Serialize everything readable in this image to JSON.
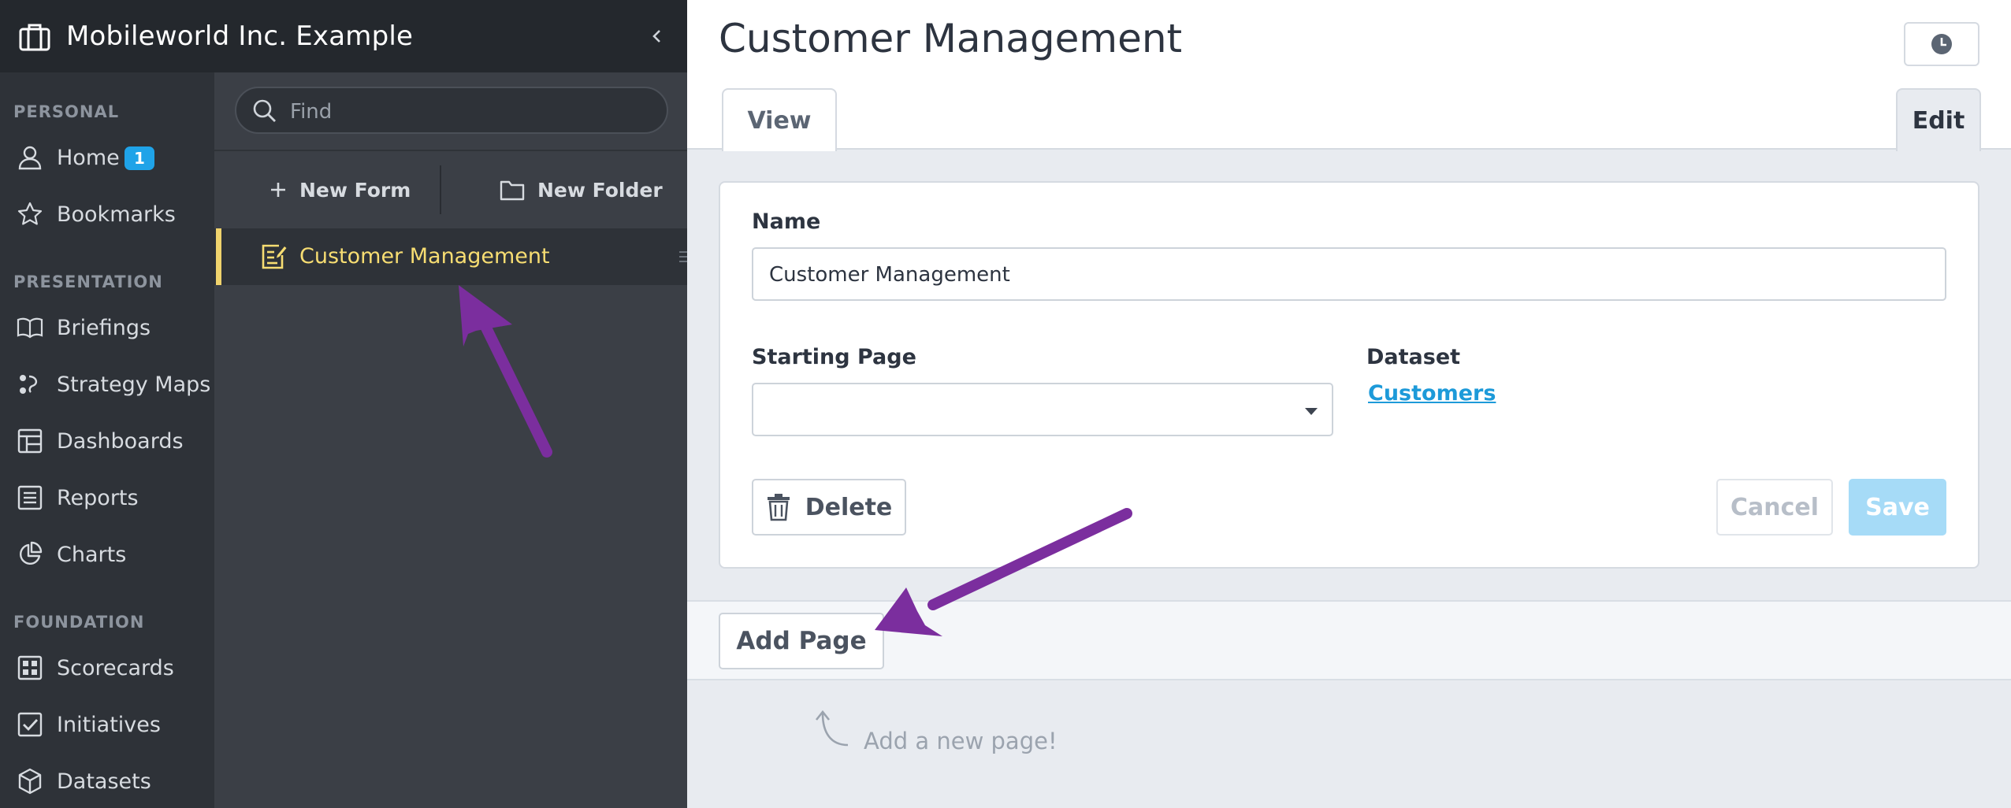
{
  "org": {
    "name": "Mobileworld Inc. Example",
    "icon": "briefcase-icon"
  },
  "sidebar": {
    "sections": [
      {
        "heading": "PERSONAL"
      },
      {
        "heading": "PRESENTATION"
      },
      {
        "heading": "FOUNDATION"
      }
    ],
    "items": [
      {
        "label": "Home",
        "icon": "user-icon",
        "badge": "1"
      },
      {
        "label": "Bookmarks",
        "icon": "star-icon"
      },
      {
        "label": "Briefings",
        "icon": "book-icon"
      },
      {
        "label": "Strategy Maps",
        "icon": "strategy-map-icon"
      },
      {
        "label": "Dashboards",
        "icon": "dashboard-icon"
      },
      {
        "label": "Reports",
        "icon": "list-icon"
      },
      {
        "label": "Charts",
        "icon": "pie-chart-icon"
      },
      {
        "label": "Scorecards",
        "icon": "scorecard-icon"
      },
      {
        "label": "Initiatives",
        "icon": "checkbox-icon"
      },
      {
        "label": "Datasets",
        "icon": "cube-icon"
      }
    ]
  },
  "panel": {
    "search_placeholder": "Find",
    "new_form_label": "New Form",
    "new_folder_label": "New Folder",
    "tree": [
      {
        "label": "Customer Management",
        "icon": "form-icon",
        "selected": true
      }
    ]
  },
  "main": {
    "title": "Customer Management",
    "tabs": {
      "view": "View",
      "edit": "Edit"
    },
    "form": {
      "name_label": "Name",
      "name_value": "Customer Management",
      "starting_page_label": "Starting Page",
      "starting_page_value": "",
      "dataset_label": "Dataset",
      "dataset_value": "Customers"
    },
    "buttons": {
      "delete": "Delete",
      "cancel": "Cancel",
      "save": "Save"
    },
    "add_page_label": "Add Page",
    "add_page_hint": "Add a new page!"
  },
  "colors": {
    "accent": "#1fa3e8",
    "selected_item": "#f7dd72",
    "annotation_arrow": "#7b2e9e",
    "save_disabled": "#a6dbf7"
  }
}
